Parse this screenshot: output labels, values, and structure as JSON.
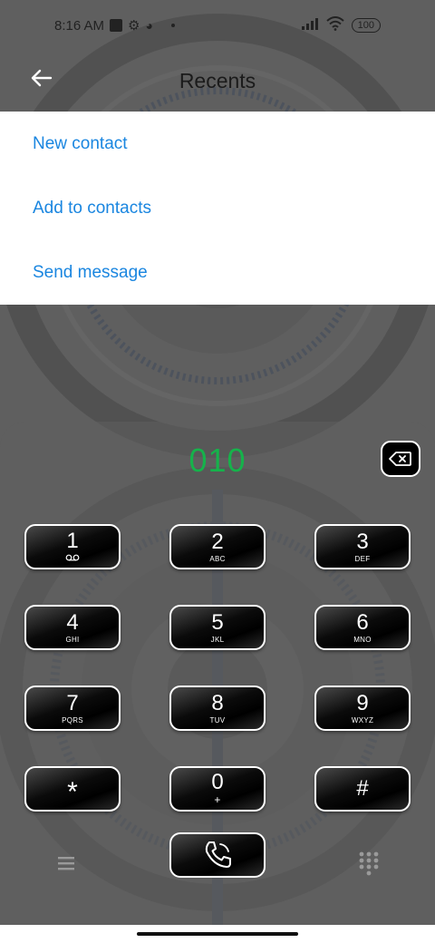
{
  "status_bar": {
    "time": "8:16 AM",
    "battery": "100"
  },
  "header": {
    "title": "Recents"
  },
  "popup_menu": {
    "items": [
      {
        "label": "New contact"
      },
      {
        "label": "Add to contacts"
      },
      {
        "label": "Send message"
      }
    ]
  },
  "dialer": {
    "number": "010",
    "keys": [
      {
        "digit": "1",
        "letters": ""
      },
      {
        "digit": "2",
        "letters": "ABC"
      },
      {
        "digit": "3",
        "letters": "DEF"
      },
      {
        "digit": "4",
        "letters": "GHI"
      },
      {
        "digit": "5",
        "letters": "JKL"
      },
      {
        "digit": "6",
        "letters": "MNO"
      },
      {
        "digit": "7",
        "letters": "PQRS"
      },
      {
        "digit": "8",
        "letters": "TUV"
      },
      {
        "digit": "9",
        "letters": "WXYZ"
      },
      {
        "digit": "*",
        "letters": ""
      },
      {
        "digit": "0",
        "letters": "+"
      },
      {
        "digit": "#",
        "letters": ""
      }
    ]
  },
  "colors": {
    "accent": "#1a86e0",
    "number": "#16b24b",
    "overlay": "#5f5f5f"
  },
  "icons": {
    "back": "arrow-left-icon",
    "backspace": "backspace-icon",
    "call": "phone-icon",
    "menu": "hamburger-icon",
    "dialpad": "dialpad-icon",
    "voicemail": "voicemail-icon"
  }
}
